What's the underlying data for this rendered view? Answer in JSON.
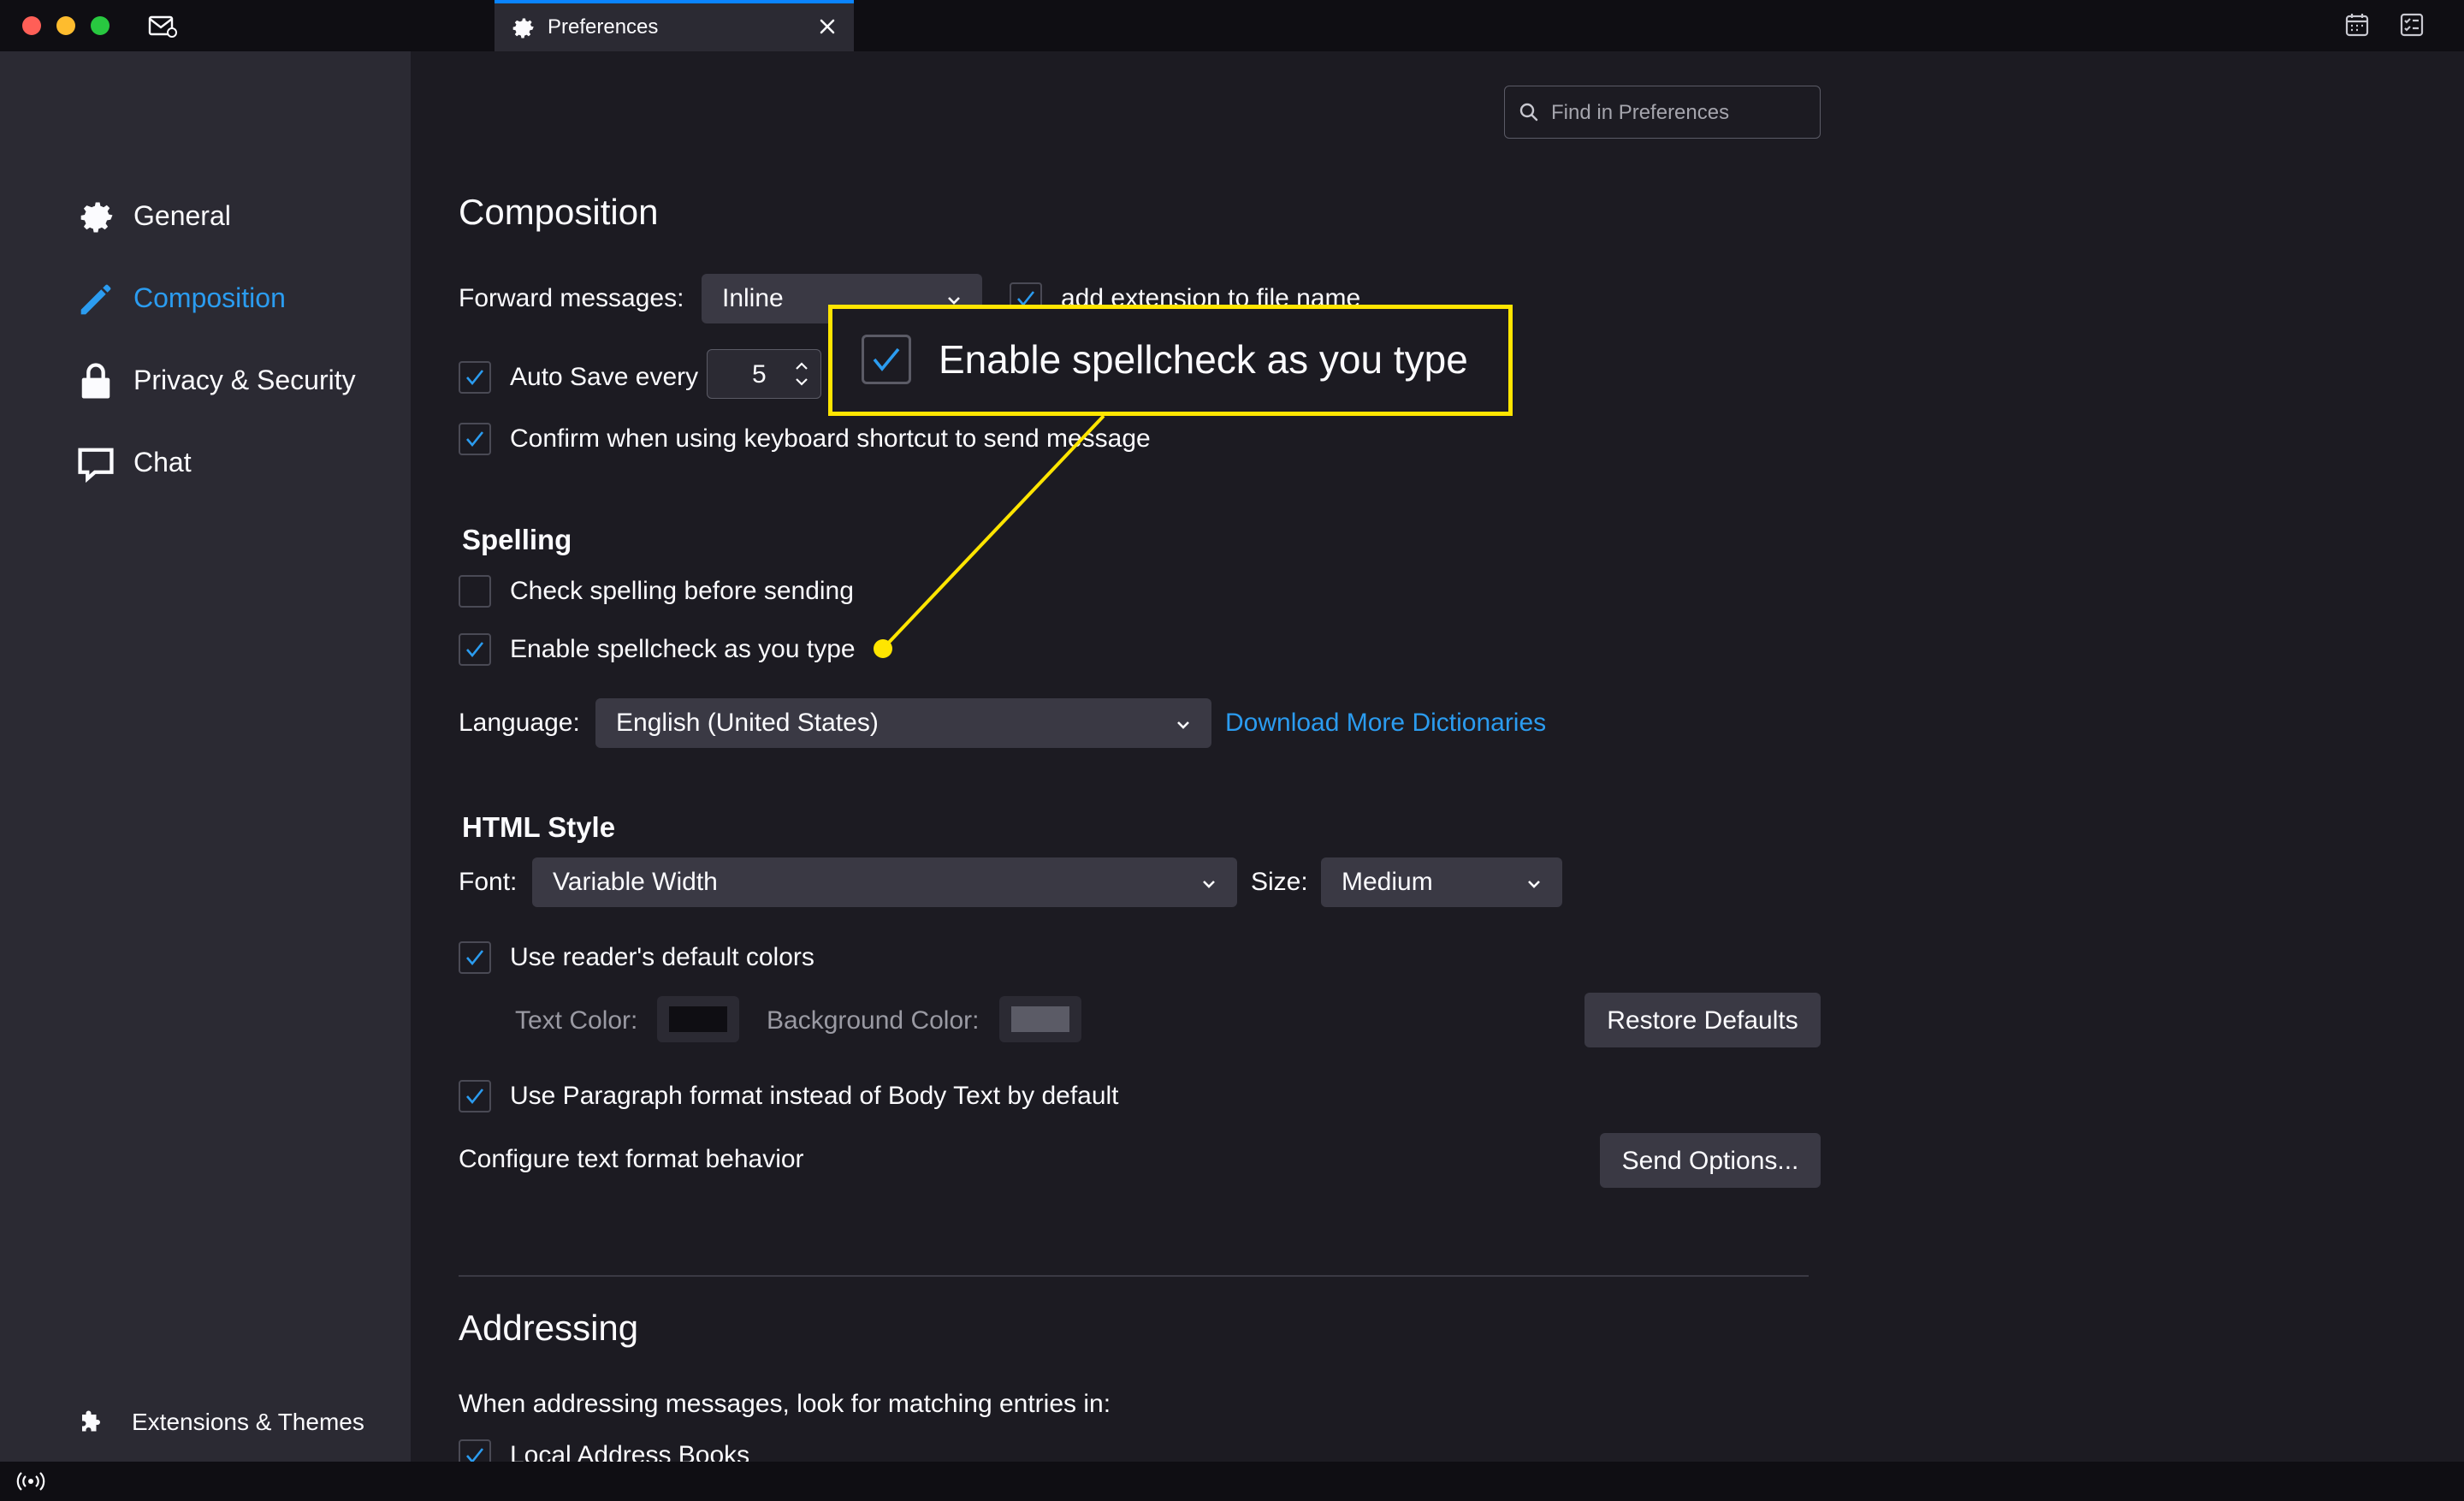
{
  "window": {
    "tab_title": "Preferences",
    "tab_icon": "gear-icon",
    "close_icon": "close-icon"
  },
  "search": {
    "placeholder": "Find in Preferences"
  },
  "sidebar": {
    "items": [
      {
        "label": "General",
        "icon": "gear-icon",
        "active": false
      },
      {
        "label": "Composition",
        "icon": "pencil-icon",
        "active": true
      },
      {
        "label": "Privacy & Security",
        "icon": "lock-icon",
        "active": false
      },
      {
        "label": "Chat",
        "icon": "chat-icon",
        "active": false
      }
    ],
    "extensions_label": "Extensions & Themes"
  },
  "composition": {
    "title": "Composition",
    "forward_label": "Forward messages:",
    "forward_value": "Inline",
    "add_extension_label": "add extension to file name",
    "add_extension_checked": true,
    "autosave_label": "Auto Save every",
    "autosave_value": "5",
    "autosave_checked": true,
    "confirm_label": "Confirm when using keyboard shortcut to send message",
    "confirm_checked": true
  },
  "spelling": {
    "title": "Spelling",
    "check_before_label": "Check spelling before sending",
    "check_before_checked": false,
    "spellcheck_label": "Enable spellcheck as you type",
    "spellcheck_checked": true,
    "language_label": "Language:",
    "language_value": "English (United States)",
    "download_link": "Download More Dictionaries"
  },
  "html_style": {
    "title": "HTML Style",
    "font_label": "Font:",
    "font_value": "Variable Width",
    "size_label": "Size:",
    "size_value": "Medium",
    "reader_colors_label": "Use reader's default colors",
    "reader_colors_checked": true,
    "text_color_label": "Text Color:",
    "text_color": "#0f0e13",
    "bg_color_label": "Background Color:",
    "bg_color": "#5b5b66",
    "restore_label": "Restore Defaults",
    "paragraph_label": "Use Paragraph format instead of Body Text by default",
    "paragraph_checked": true,
    "configure_label": "Configure text format behavior",
    "send_options_label": "Send Options..."
  },
  "addressing": {
    "title": "Addressing",
    "description": "When addressing messages, look for matching entries in:",
    "local_books_label": "Local Address Books",
    "local_books_checked": true
  },
  "callout": {
    "text": "Enable spellcheck as you type",
    "color": "#ffe500"
  },
  "colors": {
    "accent": "#2b9cf0",
    "highlight": "#ffe500"
  }
}
